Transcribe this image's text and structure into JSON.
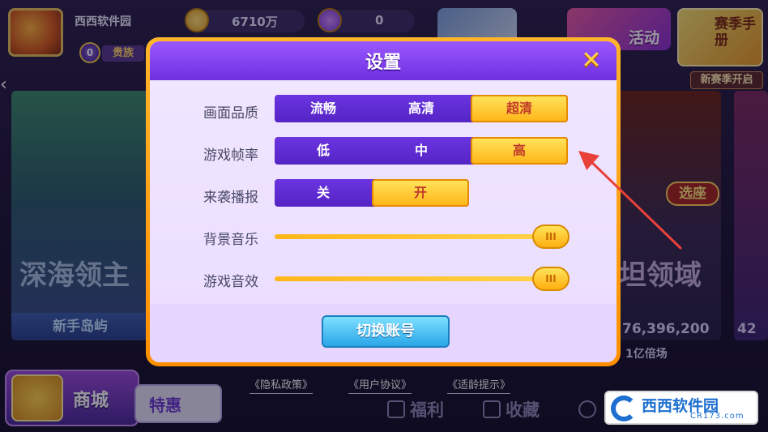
{
  "header": {
    "username": "西西软件园",
    "vip_level": "0",
    "vip_label": "贵族",
    "coins": "6710万",
    "gems": "0"
  },
  "top_cards": {
    "activity": "活动",
    "season_manual": "赛季手册",
    "season_start": "新赛季开启"
  },
  "background": {
    "card1_title": "深海领主",
    "card1_footer": "新手岛屿",
    "card2_select": "选座",
    "card2_title": "坦领域",
    "card2_jackpot": "76,396,200",
    "card2_label": "1亿倍场",
    "card3_jackpot": "42"
  },
  "settings": {
    "title": "设置",
    "close_icon": "close-icon",
    "quality": {
      "label": "画面品质",
      "options": [
        "流畅",
        "高清",
        "超清"
      ],
      "selected": 2
    },
    "framerate": {
      "label": "游戏帧率",
      "options": [
        "低",
        "中",
        "高"
      ],
      "selected": 2
    },
    "raid_alert": {
      "label": "来袭播报",
      "options": [
        "关",
        "开"
      ],
      "selected": 1
    },
    "bgm": {
      "label": "背景音乐",
      "level": 1.0,
      "knob": "III"
    },
    "sfx": {
      "label": "游戏音效",
      "level": 1.0,
      "knob": "III"
    },
    "switch_account": "切换账号"
  },
  "links": {
    "privacy": "《隐私政策》",
    "agreement": "《用户协议》",
    "age": "《适龄提示》"
  },
  "bottom_nav": {
    "shop": "商城",
    "deals": "特惠",
    "welfare": "福利",
    "collect": "收藏"
  },
  "watermark": {
    "text": "西西软件园",
    "sub": "CR173.com"
  },
  "colors": {
    "accent_purple": "#6b34e0",
    "accent_gold": "#ffb619",
    "selected_text": "#c0392b"
  }
}
